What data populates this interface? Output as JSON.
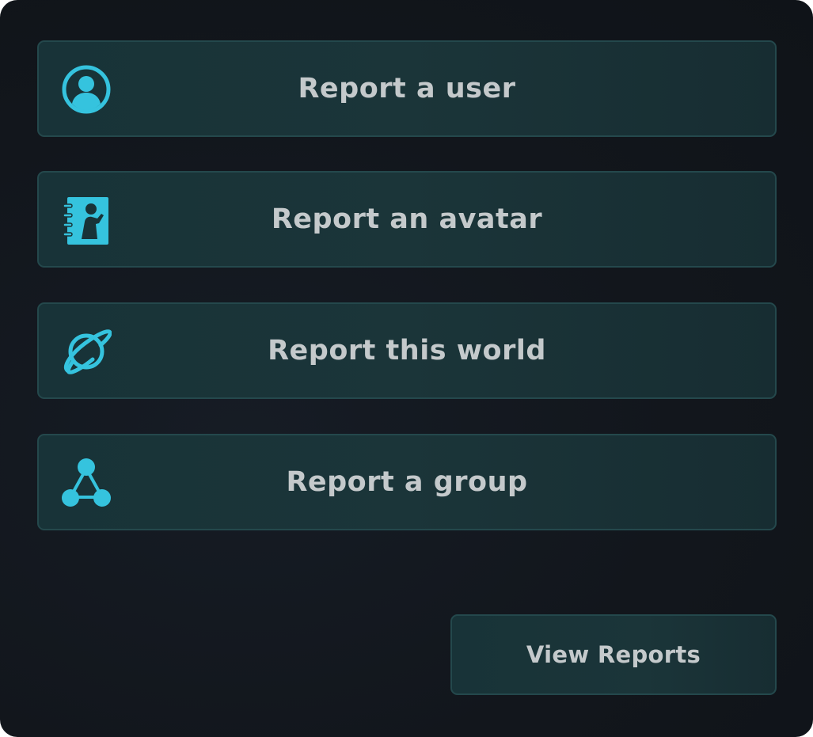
{
  "colors": {
    "accent": "#35c3de",
    "text": "#c4c9cb",
    "button_bg": "#1a3438",
    "button_border": "#24484c",
    "panel_bg": "#12161c"
  },
  "report_buttons": [
    {
      "label": "Report a user",
      "icon": "user-circle-icon"
    },
    {
      "label": "Report an avatar",
      "icon": "avatar-book-icon"
    },
    {
      "label": "Report this world",
      "icon": "planet-icon"
    },
    {
      "label": "Report a group",
      "icon": "group-nodes-icon"
    }
  ],
  "view_reports": {
    "label": "View Reports"
  }
}
